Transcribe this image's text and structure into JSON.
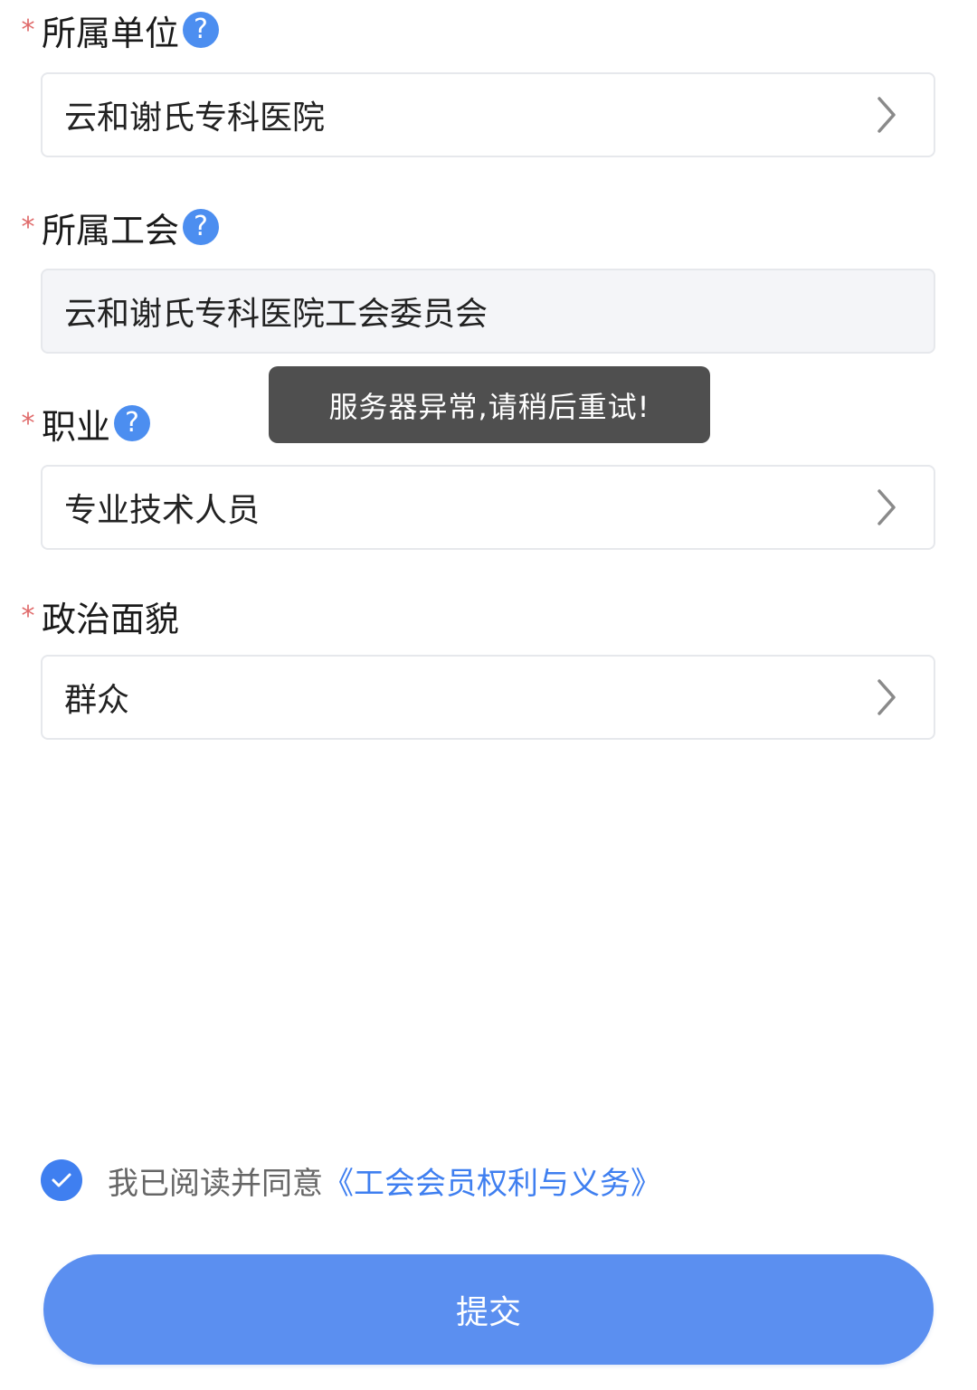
{
  "colors": {
    "accent": "#4c8ef0",
    "required": "#e06b6b",
    "toast_bg": "#4f4f4f",
    "submit_bg": "#5b8ff0"
  },
  "fields": {
    "unit": {
      "required_mark": "*",
      "label": "所属单位",
      "help_icon": "?",
      "value": "云和谢氏专科医院",
      "icon": "chevron-right-icon"
    },
    "union": {
      "required_mark": "*",
      "label": "所属工会",
      "help_icon": "?",
      "value": "云和谢氏专科医院工会委员会"
    },
    "occupation": {
      "required_mark": "*",
      "label": "职业",
      "help_icon": "?",
      "value": "专业技术人员",
      "icon": "chevron-right-icon"
    },
    "political": {
      "required_mark": "*",
      "label": "政治面貌",
      "value": "群众",
      "icon": "chevron-right-icon"
    }
  },
  "toast": {
    "message": "服务器异常,请稍后重试!"
  },
  "agreement": {
    "checked": true,
    "text": "我已阅读并同意",
    "link": "《工会会员权利与义务》"
  },
  "submit": {
    "label": "提交"
  }
}
